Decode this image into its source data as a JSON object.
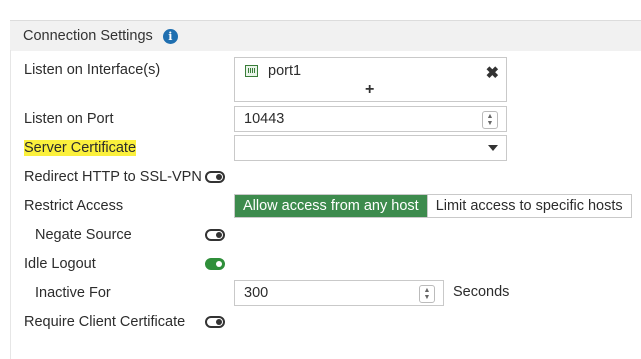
{
  "section": {
    "title": "Connection Settings",
    "info_icon": "info-icon"
  },
  "fields": {
    "listen_interfaces": {
      "label": "Listen on Interface(s)",
      "items": [
        "port1"
      ],
      "add_symbol": "+",
      "remove_symbol": "✖"
    },
    "listen_port": {
      "label": "Listen on Port",
      "value": "10443"
    },
    "server_certificate": {
      "label": "Server Certificate",
      "value": "",
      "highlighted": true,
      "highlight_color": "#fbf03c"
    },
    "redirect_http": {
      "label": "Redirect HTTP to SSL-VPN",
      "enabled": false
    },
    "restrict_access": {
      "label": "Restrict Access",
      "options": [
        "Allow access from any host",
        "Limit access to specific hosts"
      ],
      "selected": "Allow access from any host",
      "active_color": "#3d8b4d"
    },
    "negate_source": {
      "label": "Negate Source",
      "enabled": false
    },
    "idle_logout": {
      "label": "Idle Logout",
      "enabled": true,
      "on_color": "#2f8f3a"
    },
    "inactive_for": {
      "label": "Inactive For",
      "value": "300",
      "suffix": "Seconds"
    },
    "require_client_cert": {
      "label": "Require Client Certificate",
      "enabled": false
    }
  }
}
